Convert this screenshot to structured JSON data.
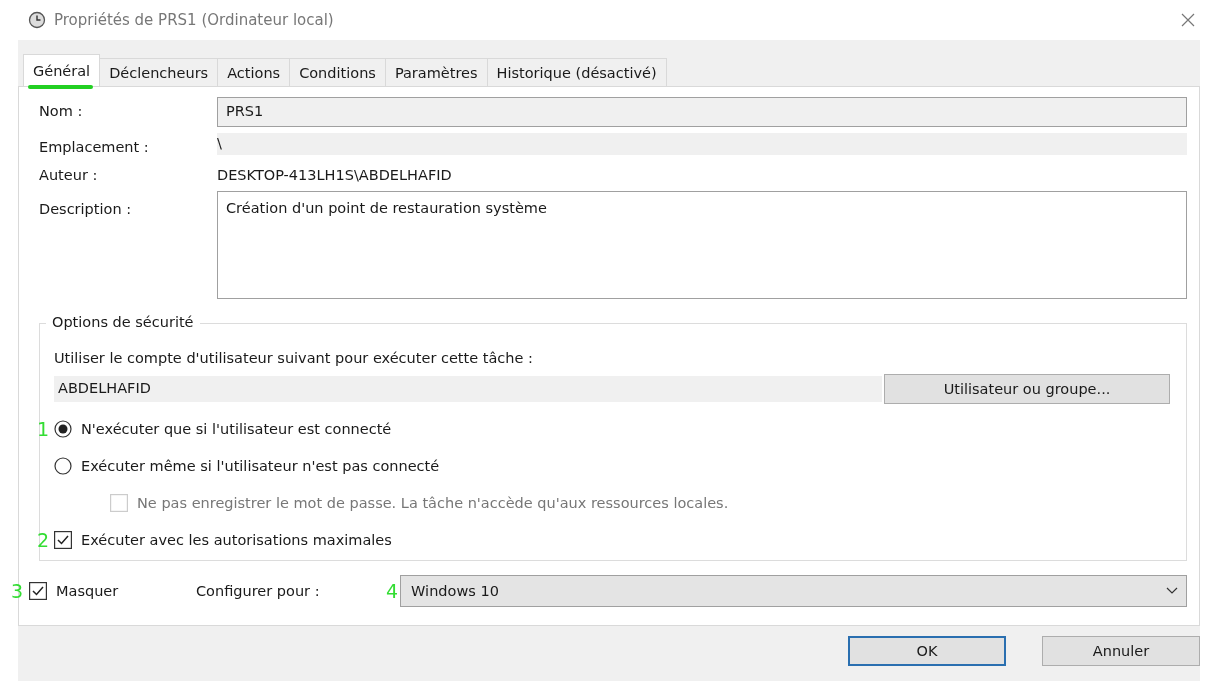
{
  "window": {
    "title": "Propriétés de PRS1 (Ordinateur local)"
  },
  "tabs": [
    {
      "label": "Général",
      "selected": true
    },
    {
      "label": "Déclencheurs",
      "selected": false
    },
    {
      "label": "Actions",
      "selected": false
    },
    {
      "label": "Conditions",
      "selected": false
    },
    {
      "label": "Paramètres",
      "selected": false
    },
    {
      "label": "Historique (désactivé)",
      "selected": false
    }
  ],
  "fields": [
    {
      "label": "Nom :",
      "kind": "input",
      "value": "PRS1"
    },
    {
      "label": "Emplacement :",
      "kind": "readonly",
      "value": "\\"
    },
    {
      "label": "Auteur :",
      "kind": "text",
      "value": "DESKTOP-413LH1S\\ABDELHAFID"
    },
    {
      "label": "Description :",
      "kind": "area",
      "value": "Création d'un point de restauration système"
    }
  ],
  "security": {
    "title": "Options de sécurité",
    "account_label": "Utiliser le compte d'utilisateur suivant pour exécuter cette tâche :",
    "account": "ABDELHAFID",
    "account_button": "Utilisateur ou groupe...",
    "options": [
      {
        "kind": "radio",
        "annotation": "1",
        "label": "N'exécuter que si l'utilisateur est connecté",
        "selected": true
      },
      {
        "kind": "radio",
        "label": "Exécuter même si l'utilisateur n'est pas connecté",
        "selected": false
      },
      {
        "kind": "checkbox",
        "label": "Ne pas enregistrer le mot de passe. La tâche n'accède qu'aux ressources locales.",
        "checked": false,
        "disabled": true
      },
      {
        "kind": "checkbox",
        "annotation": "2",
        "label": "Exécuter avec les autorisations maximales",
        "checked": true
      }
    ]
  },
  "hidden": {
    "annotation": "3",
    "label": "Masquer",
    "checked": true
  },
  "configure": {
    "label": "Configurer pour :",
    "annotation": "4",
    "value": "Windows 10"
  },
  "buttons": [
    {
      "label": "OK",
      "default": true
    },
    {
      "label": "Annuler",
      "default": false
    }
  ]
}
